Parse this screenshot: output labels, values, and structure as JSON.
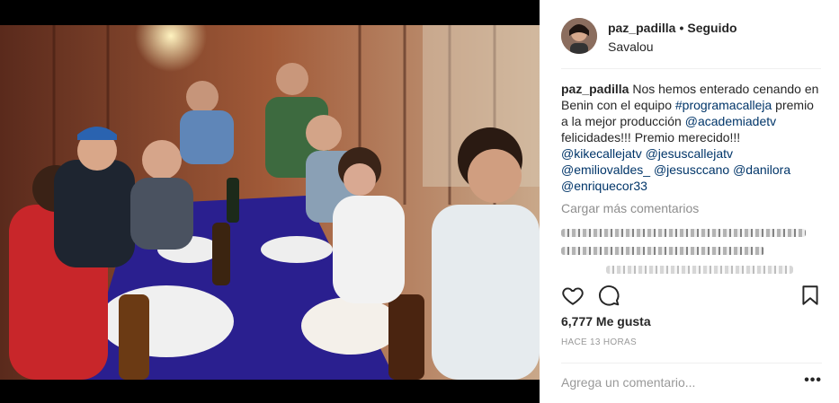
{
  "header": {
    "username": "paz_padilla",
    "separator": "•",
    "follow_status": "Seguido",
    "location": "Savalou"
  },
  "caption": {
    "username": "paz_padilla",
    "text_1": " Nos hemos enterado cenando en Benin con el equipo ",
    "hashtag": "#programacalleja",
    "text_2": " premio a la mejor producción ",
    "mention_1": "@academiadetv",
    "text_3": " felicidades!!! Premio merecido!!! ",
    "mention_2": "@kikecallejatv",
    "mention_3": "@jesuscallejatv",
    "mention_4": "@emiliovaldes_",
    "mention_5": "@jesusccano",
    "mention_6": "@danilora",
    "mention_7": "@enriquecor33"
  },
  "comments": {
    "load_more_label": "Cargar más comentarios"
  },
  "actions": {
    "like_icon": "heart-outline-icon",
    "comment_icon": "speech-bubble-icon",
    "save_icon": "bookmark-icon"
  },
  "likes": "6,777 Me gusta",
  "timestamp": "HACE 13 HORAS",
  "comment_input": {
    "placeholder": "Agrega un comentario...",
    "more_label": "•••"
  },
  "colors": {
    "link": "#003569",
    "muted": "#8e8e8e",
    "text": "#262626",
    "table_blue": "#2a1f8f"
  }
}
